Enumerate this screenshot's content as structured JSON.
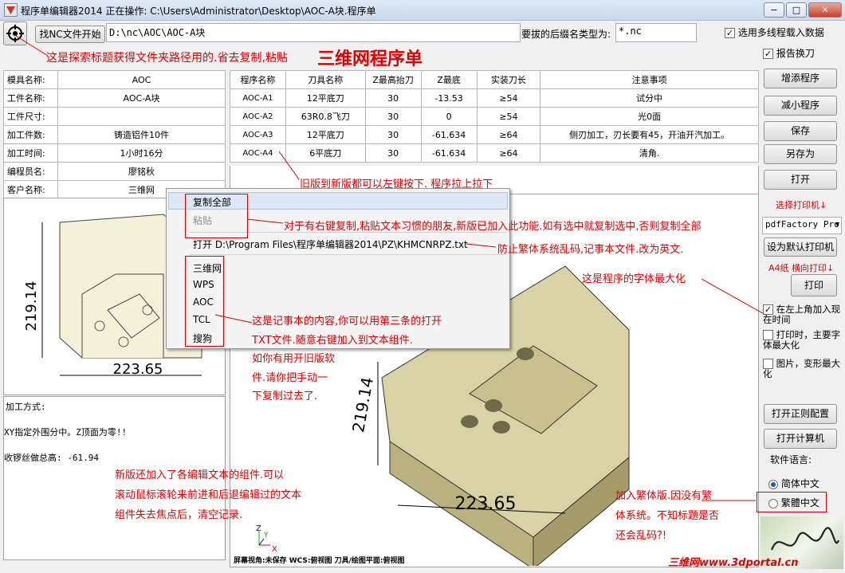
{
  "window": {
    "title": "程序单编辑器2014  正在操作: C:\\Users\\Administrator\\Desktop\\AOC-A块.程序单",
    "min": "−",
    "max": "□",
    "close": "✕"
  },
  "toolbar": {
    "find_button": "找NC文件开始",
    "path_value": "D:\\nc\\AOC\\AOC-A块",
    "suffix_label": "要拔的后缀名类型为:",
    "suffix_value": "*.nc",
    "multiline_label": "选用多线程载入数据"
  },
  "info": [
    {
      "label": "模具名称:",
      "value": "AOC"
    },
    {
      "label": "工件名称:",
      "value": "AOC-A块"
    },
    {
      "label": "工件尺寸:",
      "value": ""
    },
    {
      "label": "加工件数:",
      "value": "铸造铝件10件"
    },
    {
      "label": "加工时间:",
      "value": "1小时16分"
    },
    {
      "label": "编程员名:",
      "value": "廖铭秋"
    },
    {
      "label": "客户名称:",
      "value": "三维网"
    }
  ],
  "program_table": {
    "headers": [
      "程序名称",
      "刀具名称",
      "Z最高抬刀",
      "Z最底",
      "实装刀长",
      "注意事项"
    ],
    "rows": [
      [
        "AOC-A1",
        "12平底刀",
        "30",
        "-13.53",
        "≥54",
        "试分中"
      ],
      [
        "AOC-A2",
        "63R0.8飞刀",
        "30",
        "0",
        "≥54",
        "光0面"
      ],
      [
        "AOC-A3",
        "12平底刀",
        "30",
        "-61.634",
        "≥64",
        "侧刃加工，刃长要有45，开油开汽加工。"
      ],
      [
        "AOC-A4",
        "6平底刀",
        "30",
        "-61.634",
        "≥64",
        "清角."
      ]
    ]
  },
  "notes": {
    "method_label": "加工方式:",
    "line1": "XY指定外围分中。Z顶面为零!!",
    "line2": "收锣丝做总高: -61.94"
  },
  "drawing": {
    "dim_height": "219.14",
    "dim_width": "223.65"
  },
  "view3d": {
    "dim_height": "219.14",
    "dim_width": "223.65",
    "status": "屏幕视角:未保存   WCS:俯视图   刀具/绘图平面:俯视图",
    "axis_z": "Z",
    "axis_x": "X",
    "axis_y": "Y"
  },
  "context_menu": {
    "copy_all": "复制全部",
    "paste": "粘贴",
    "open": "打开  D:\\Program Files\\程序单编辑器2014\\PZ\\KHMCNRPZ.txt",
    "items": [
      "三维网",
      "WPS",
      "AOC",
      "TCL",
      "搜狗"
    ]
  },
  "sidebar": {
    "report_wrap": "报告换刀",
    "add_program": "增添程序",
    "remove_program": "减小程序",
    "save": "保存",
    "save_as": "另存为",
    "open": "打开",
    "printer_label": "选择打印机↓",
    "printer_value": "pdfFactory Pro",
    "set_default_printer": "设为默认打印机",
    "paper_label": "A4纸  横向打印↓",
    "print": "打印",
    "opt_time": "在左上角加入现在时间",
    "opt_font": "打印时，主要字体最大化",
    "opt_image": "图片，变形最大化",
    "open_config": "打开正则配置",
    "open_calc": "打开计算机",
    "lang_label": "软件语言:",
    "lang_simplified": "简体中文",
    "lang_traditional": "繁體中文"
  },
  "annotations": {
    "a1": "这是探索标题获得文件夹路径用的.省去复制,粘贴",
    "big_title": "三维网程序单",
    "a2": "旧版到新版都可以左键按下. 程序拉上拉下",
    "a3": "对于有右键复制,粘贴文本习惯的朋友,新版已加入此功能.如有选中就复制选中,否则复制全部",
    "a4": "防止繁体系统乱码,记事本文件.改为英文.",
    "a5": "这是程序的字体最大化",
    "a6": [
      "这是记事本的内容,你可以用第三条的打开",
      "TXT文件.随意右键加入到文本组件.",
      "如你有用开旧版软",
      "件.请你把手动一",
      "下复制过去了."
    ],
    "a7": [
      "新版还加入了各编辑文本的组件.可以",
      "滚动鼠标滚轮来前进和后退编辑过的文本",
      "组件失去焦点后，清空记录."
    ],
    "a8": [
      "加入繁体版.因没有繁",
      "体系统。不知标题是否",
      "还会乱码?!"
    ]
  },
  "watermark": "三维网www.3dportal.cn"
}
